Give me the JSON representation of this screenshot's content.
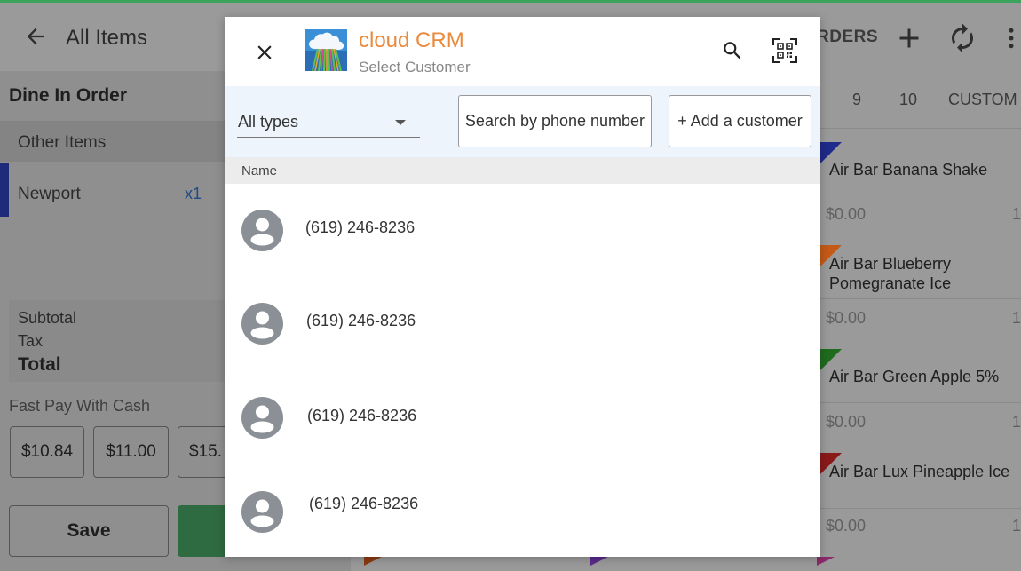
{
  "app": {
    "title": "All Items",
    "orders_label": "RDERS"
  },
  "order": {
    "title": "Dine In Order",
    "section_label": "Other Items",
    "items": [
      {
        "name": "Newport",
        "qty": "x1"
      }
    ],
    "subtotal_label": "Subtotal",
    "tax_label": "Tax",
    "total_label": "Total",
    "fast_pay_label": "Fast Pay With Cash",
    "cash_options": [
      "$10.84",
      "$11.00",
      "$15."
    ],
    "save_label": "Save"
  },
  "categories": [
    "9",
    "10",
    "CUSTOM"
  ],
  "products": [
    {
      "name": "Air Bar Banana Shake",
      "price": "$0.00",
      "count": "1",
      "color": "#1f2a8a"
    },
    {
      "name": "Air Bar Blueberry Pomegranate Ice",
      "price": "$0.00",
      "count": "1",
      "color": "#c45a17"
    },
    {
      "name": "Air Bar Green Apple 5%",
      "price": "$0.00",
      "count": "1",
      "color": "#1f6b1f"
    },
    {
      "name": "Air Bar Lux Pineapple Ice",
      "price": "$0.00",
      "count": "1",
      "color": "#8a1a1a"
    }
  ],
  "modal": {
    "title": "cloud CRM",
    "subtitle": "Select Customer",
    "type_filter": "All types",
    "phone_search_label": "Search by phone number",
    "add_customer_label": "+ Add a customer",
    "column_name": "Name",
    "customers": [
      {
        "phone": "(619) 246-8236"
      },
      {
        "phone": "(619) 246-8236"
      },
      {
        "phone": "(619) 246-8236"
      },
      {
        "phone": "(619) 246-8236"
      }
    ]
  },
  "colors": {
    "brand_orange": "#e98a3c",
    "toolbar_bg": "#edf4fb",
    "avatar_gray": "#8a9096"
  },
  "icons": [
    "back-arrow-icon",
    "add-icon",
    "refresh-icon",
    "more-vert-icon",
    "close-icon",
    "cloud-logo-icon",
    "search-icon",
    "qr-scan-icon",
    "avatar-icon",
    "dropdown-arrow-icon"
  ]
}
